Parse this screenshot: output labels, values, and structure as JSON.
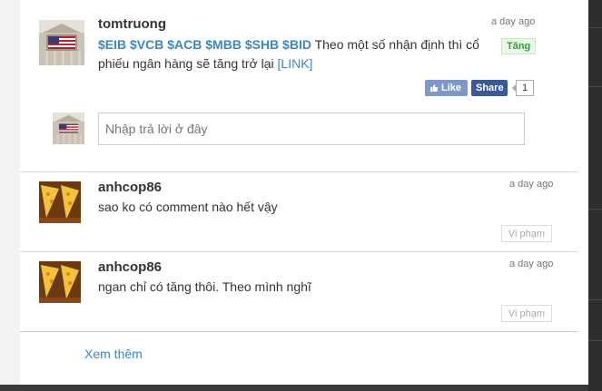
{
  "comments": [
    {
      "user": "tomtruong",
      "time": "a day ago",
      "tickers": "$EIB $VCB $ACB $MBB $SHB $BID",
      "text_line1": " Theo một số nhận định thì cổ",
      "text_line2": "phiếu ngân hàng sẽ tăng trở lại ",
      "link": "[LINK]",
      "tag": "Tăng",
      "like_label": "Like",
      "share_label": "Share",
      "share_count": "1",
      "avatar_icon": "stock-exchange-building-flag"
    },
    {
      "user": "anhcop86",
      "time": "a day ago",
      "text": "sao ko có comment nào hết vậy",
      "report_label": "Vi phạm",
      "avatar_icon": "pizza-slices"
    },
    {
      "user": "anhcop86",
      "time": "a day ago",
      "text": "ngan chỉ có tăng thôi. Theo mình nghĩ",
      "report_label": "Vi phạm",
      "avatar_icon": "pizza-slices"
    }
  ],
  "reply": {
    "placeholder": "Nhập trả lời ở đây"
  },
  "more_link": "Xem thêm",
  "colors": {
    "ticker": "#3a87c5",
    "tag_green": "#3a9a3a",
    "like_bg": "#7f97c8",
    "share_bg": "#3b5998"
  }
}
